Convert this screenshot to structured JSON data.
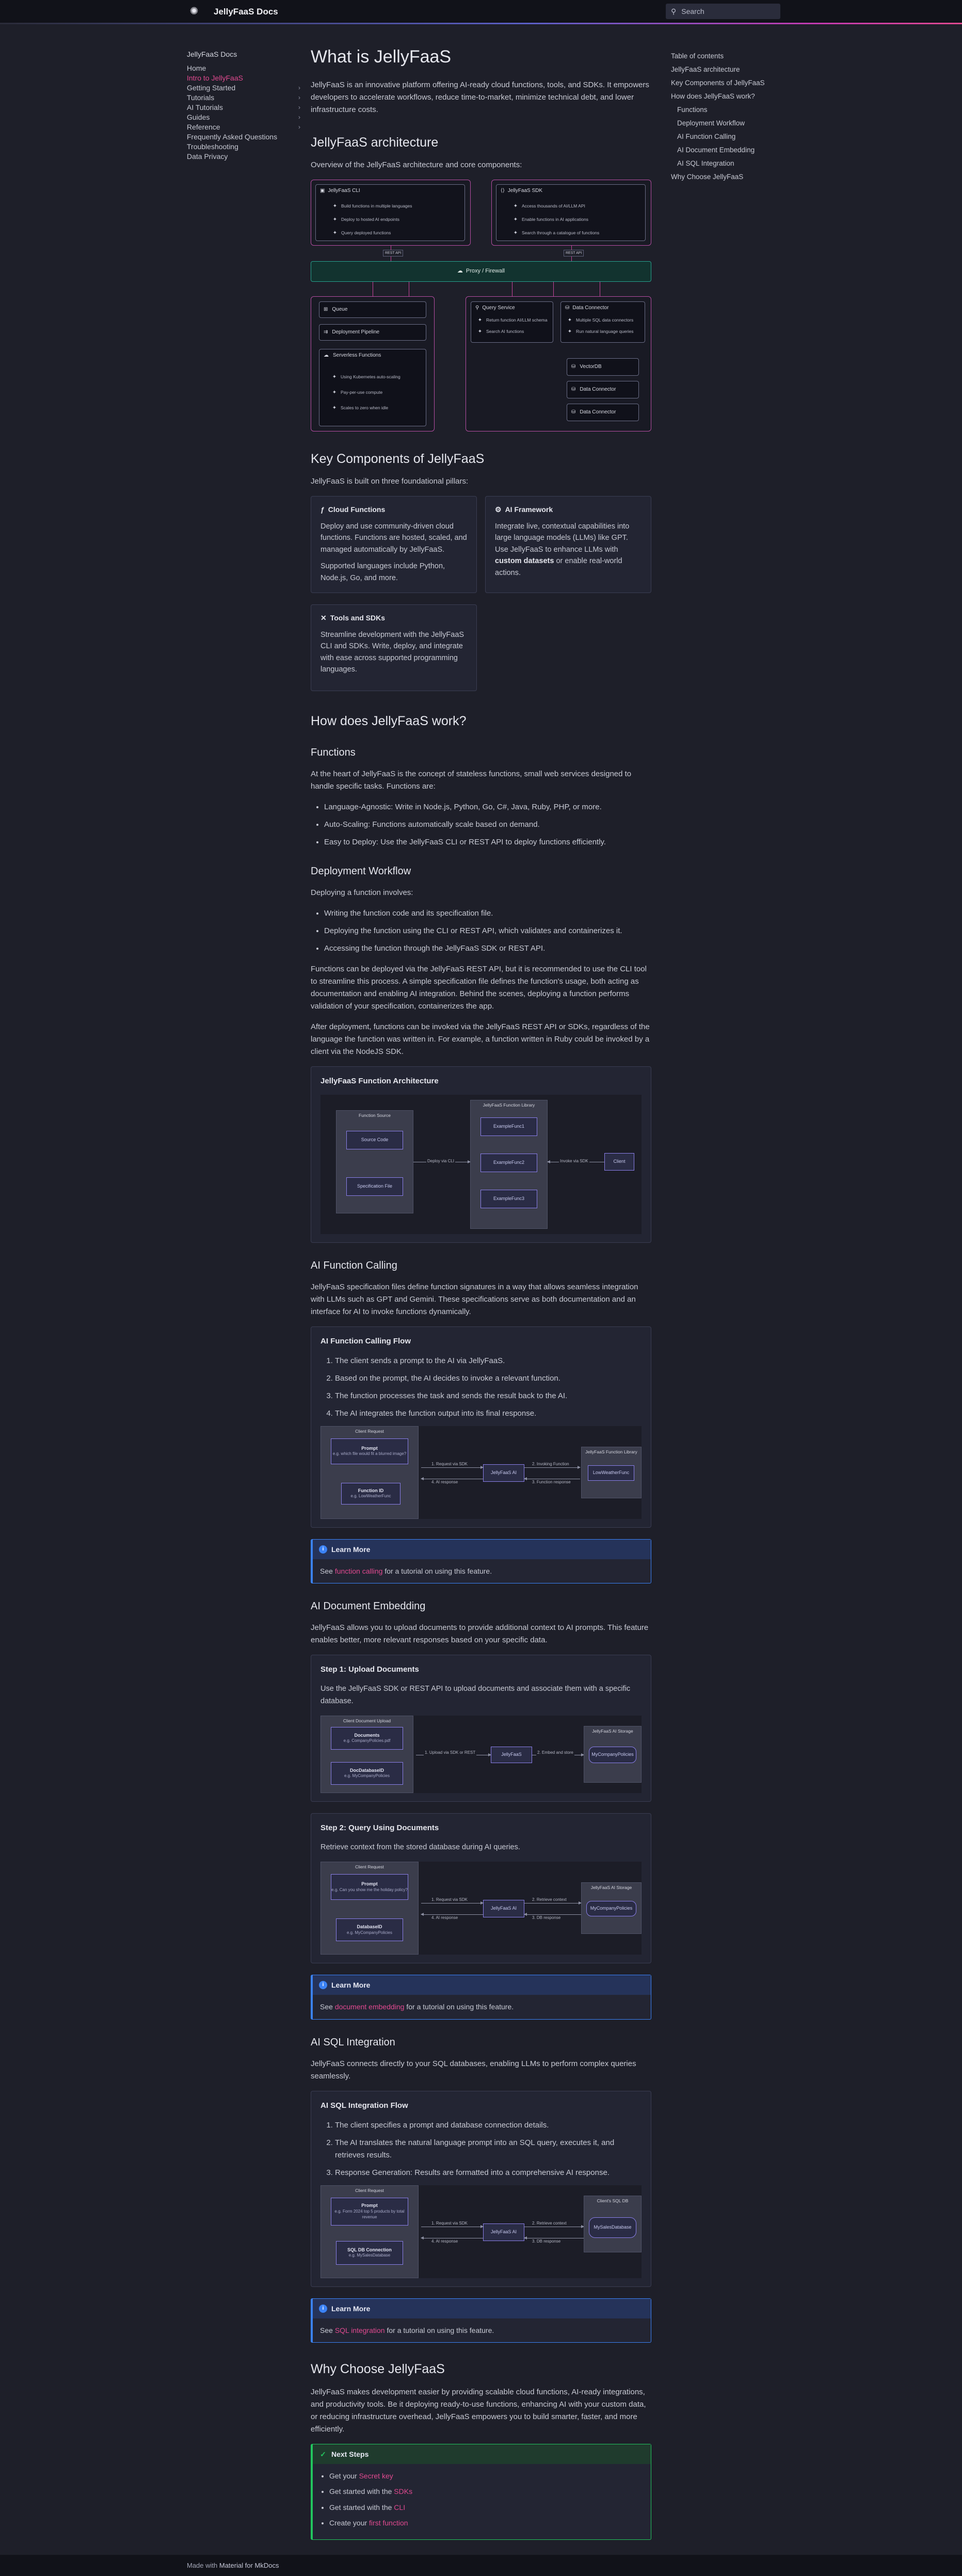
{
  "header": {
    "title": "JellyFaaS Docs",
    "search_placeholder": "Search"
  },
  "leftnav": {
    "title": "JellyFaaS Docs",
    "items": [
      {
        "label": "Home",
        "active": false,
        "chev": ""
      },
      {
        "label": "Intro to JellyFaaS",
        "active": true,
        "chev": ""
      },
      {
        "label": "Getting Started",
        "active": false,
        "chev": "›"
      },
      {
        "label": "Tutorials",
        "active": false,
        "chev": "›"
      },
      {
        "label": "AI Tutorials",
        "active": false,
        "chev": "›"
      },
      {
        "label": "Guides",
        "active": false,
        "chev": "›"
      },
      {
        "label": "Reference",
        "active": false,
        "chev": "›"
      },
      {
        "label": "Frequently Asked Questions",
        "active": false,
        "chev": ""
      },
      {
        "label": "Troubleshooting",
        "active": false,
        "chev": ""
      },
      {
        "label": "Data Privacy",
        "active": false,
        "chev": ""
      }
    ]
  },
  "toc": {
    "title": "Table of contents",
    "items": [
      {
        "label": "JellyFaaS architecture",
        "level": 1
      },
      {
        "label": "Key Components of JellyFaaS",
        "level": 1
      },
      {
        "label": "How does JellyFaaS work?",
        "level": 1
      },
      {
        "label": "Functions",
        "level": 2
      },
      {
        "label": "Deployment Workflow",
        "level": 2
      },
      {
        "label": "AI Function Calling",
        "level": 2
      },
      {
        "label": "AI Document Embedding",
        "level": 2
      },
      {
        "label": "AI SQL Integration",
        "level": 2
      },
      {
        "label": "Why Choose JellyFaaS",
        "level": 1
      }
    ]
  },
  "page": {
    "title": "What is JellyFaaS",
    "intro": "JellyFaaS is an innovative platform offering AI-ready cloud functions, tools, and SDKs. It empowers developers to accelerate workflows, reduce time-to-market, minimize technical debt, and lower infrastructure costs.",
    "arch_heading": "JellyFaaS architecture",
    "arch_intro": "Overview of the JellyFaaS architecture and core components:",
    "arch": {
      "cli": "JellyFaaS CLI",
      "cli_items": [
        "Build functions in multiple languages",
        "Deploy to hosted AI endpoints",
        "Query deployed functions"
      ],
      "sdk": "JellyFaaS SDK",
      "sdk_items": [
        "Access thousands of AI/LLM API",
        "Enable functions in AI applications",
        "Search through a catalogue of functions"
      ],
      "tag_left": "REST API",
      "tag_right": "REST API",
      "proxy": "Proxy / Firewall",
      "deploy_1": "Queue",
      "deploy_2": "Deployment Pipeline",
      "serverless": "Serverless Functions",
      "serverless_items": [
        "Using Kubernetes auto-scaling",
        "Pay-per-use compute",
        "Scales to zero when idle"
      ],
      "query": "Query Service",
      "query_items": [
        "Return function AI/LLM schema",
        "Search AI functions"
      ],
      "dc": "Data Connector",
      "dc_items": [
        "Multiple SQL data connectors",
        "Run natural language queries"
      ],
      "vector": "VectorDB",
      "dc2": "Data Connector",
      "dc3": "Data Connector"
    },
    "components_heading": "Key Components of JellyFaaS",
    "components_intro": "JellyFaaS is built on three foundational pillars:",
    "card_cloud": {
      "title": "Cloud Functions",
      "p1": "Deploy and use community-driven cloud functions. Functions are hosted, scaled, and managed automatically by JellyFaaS.",
      "p2": "Supported languages include Python, Node.js, Go, and more."
    },
    "card_ai": {
      "title": "AI Framework",
      "p1a": "Integrate live, contextual capabilities into large language models (LLMs) like GPT. Use JellyFaaS to enhance LLMs with ",
      "p1b": "custom datasets",
      "p1c": " or enable real-world actions."
    },
    "card_tools": {
      "title": "Tools and SDKs",
      "p1": "Streamline development with the JellyFaaS CLI and SDKs. Write, deploy, and integrate with ease across supported programming languages."
    },
    "how_heading": "How does JellyFaaS work?",
    "functions_heading": "Functions",
    "functions_intro": "At the heart of JellyFaaS is the concept of stateless functions, small web services designed to handle specific tasks. Functions are:",
    "functions_list": [
      "Language-Agnostic: Write in Node.js, Python, Go, C#, Java, Ruby, PHP, or more.",
      "Auto-Scaling: Functions automatically scale based on demand.",
      "Easy to Deploy: Use the JellyFaaS CLI or REST API to deploy functions efficiently."
    ],
    "deploy_heading": "Deployment Workflow",
    "deploy_intro": "Deploying a function involves:",
    "deploy_list": [
      "Writing the function code and its specification file.",
      "Deploying the function using the CLI or REST API, which validates and containerizes it.",
      "Accessing the function through the JellyFaaS SDK or REST API."
    ],
    "deploy_p1": "Functions can be deployed via the JellyFaaS REST API, but it is recommended to use the CLI tool to streamline this process. A simple specification file defines the function's usage, both acting as documentation and enabling AI integration. Behind the scenes, deploying a function performs validation of your specification, containerizes the app.",
    "deploy_p2": "After deployment, functions can be invoked via the JellyFaaS REST API or SDKs, regardless of the language the function was written in. For example, a function written in Ruby could be invoked by a client via the NodeJS SDK.",
    "fa": {
      "title": "JellyFaaS Function Architecture",
      "source": "Function Source",
      "code": "Source Code",
      "spec": "Specification File",
      "deploy_via": "Deploy via CLI",
      "library": "JellyFaaS Function Library",
      "ex1": "ExampleFunc1",
      "ex2": "ExampleFunc2",
      "ex3": "ExampleFunc3",
      "invoke": "Invoke via SDK",
      "client": "Client"
    },
    "aifc_heading": "AI Function Calling",
    "aifc_intro": "JellyFaaS specification files define function signatures in a way that allows seamless integration with LLMs such as GPT and Gemini. These specifications serve as both documentation and an interface for AI to invoke functions dynamically.",
    "aifc": {
      "title": "AI Function Calling Flow",
      "steps": [
        "The client sends a prompt to the AI via JellyFaaS.",
        "Based on the prompt, the AI decides to invoke a relevant function.",
        "The function processes the task and sends the result back to the AI.",
        "The AI integrates the function output into its final response."
      ],
      "req": "Client Request",
      "prompt": "Prompt",
      "prompt_sub": "e.g. which file would fit a blurred image?",
      "fid": "Function ID",
      "fid_sub": "e.g. LowWeatherFunc",
      "a1": "1. Request via SDK",
      "a2": "4. AI response",
      "jfai": "JellyFaaS AI",
      "a3": "2. Invoking Function",
      "a4": "3. Function response",
      "lib": "JellyFaaS Function Library",
      "libfn": "LowWeatherFunc"
    },
    "learn_label": "Learn More",
    "learn_fc_a": "See ",
    "learn_fc_link": "function calling",
    "learn_fc_b": " for a tutorial on using this feature.",
    "emb_heading": "AI Document Embedding",
    "emb_intro": "JellyFaaS allows you to upload documents to provide additional context to AI prompts. This feature enables better, more relevant responses based on your specific data.",
    "emb": {
      "s1_title": "Step 1: Upload Documents",
      "s1_text": "Use the JellyFaaS SDK or REST API to upload documents and associate them with a specific database.",
      "upload": "Client Document Upload",
      "docs": "Documents",
      "docs_sub": "e.g. CompanyPolicies.pdf",
      "dbname": "DocDatabaseID",
      "dbname_sub": "e.g. MyCompanyPolicies",
      "a1": "1. Upload via SDK or REST",
      "jf": "JellyFaaS",
      "a2": "2. Embed and store",
      "store": "JellyFaaS AI Storage",
      "store_db": "MyCompanyPolicies",
      "s2_title": "Step 2: Query Using Documents",
      "s2_text": "Retrieve context from the stored database during AI queries.",
      "req": "Client Request",
      "prompt": "Prompt",
      "prompt_sub": "e.g. Can you show me the holiday policy?",
      "dbid": "DatabaseID",
      "dbid_sub": "e.g. MyCompanyPolicies",
      "b1": "1. Request via SDK",
      "b2": "4. AI response",
      "jfai": "JellyFaaS AI",
      "b3": "2. Retrieve context",
      "b4": "3. DB response",
      "store2": "JellyFaaS AI Storage",
      "store2_db": "MyCompanyPolicies"
    },
    "learn_emb_a": "See ",
    "learn_emb_link": "document embedding",
    "learn_emb_b": " for a tutorial on using this feature.",
    "sql_heading": "AI SQL Integration",
    "sql_intro": "JellyFaaS connects directly to your SQL databases, enabling LLMs to perform complex queries seamlessly.",
    "sql": {
      "title": "AI SQL Integration Flow",
      "steps": [
        "The client specifies a prompt and database connection details.",
        "The AI translates the natural language prompt into an SQL query, executes it, and retrieves results.",
        "Response Generation: Results are formatted into a comprehensive AI response."
      ],
      "req": "Client Request",
      "prompt": "Prompt",
      "prompt_sub": "e.g. Form 2024 top 5 products by total revenue",
      "conn": "SQL DB Connection",
      "conn_sub": "e.g. MySalesDatabase",
      "a1": "1. Request via SDK",
      "a2": "4. AI response",
      "jfai": "JellyFaaS AI",
      "a3": "2. Retrieve context",
      "a4": "3. DB response",
      "client_db": "Client's SQL DB",
      "client_db_name": "MySalesDatabase"
    },
    "learn_sql_a": "See ",
    "learn_sql_link": "SQL integration",
    "learn_sql_b": " for a tutorial on using this feature.",
    "why_heading": "Why Choose JellyFaaS",
    "why_p": "JellyFaaS makes development easier by providing scalable cloud functions, AI-ready integrations, and productivity tools. Be it deploying ready-to-use functions, enhancing AI with your custom data, or reducing infrastructure overhead, JellyFaaS empowers you to build smarter, faster, and more efficiently.",
    "next": {
      "label": "Next Steps",
      "items": [
        {
          "pre": "Get your ",
          "link": "Secret key"
        },
        {
          "pre": "Get started with the ",
          "link": "SDKs"
        },
        {
          "pre": "Get started with the ",
          "link": "CLI"
        },
        {
          "pre": "Create your ",
          "link": "first function"
        }
      ]
    }
  },
  "footer": {
    "pre": "Made with ",
    "link": "Material for MkDocs"
  }
}
